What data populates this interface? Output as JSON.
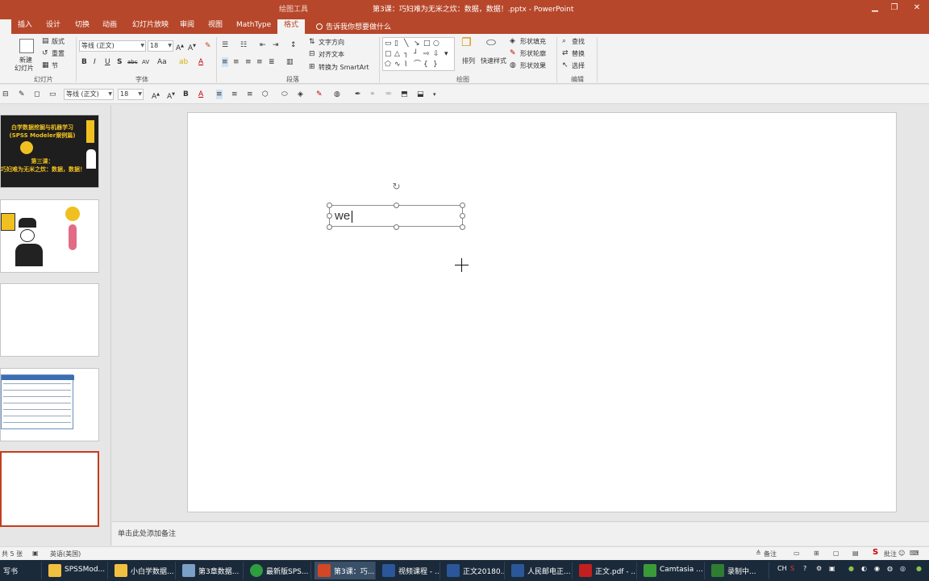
{
  "titlebar": {
    "tools_label": "绘图工具",
    "document_title": "第3课：巧妇难为无米之炊：数据，数据！.pptx  -  PowerPoint",
    "minimize": "▁",
    "restore": "❐",
    "close": "✕"
  },
  "tabs": [
    {
      "label": "插入"
    },
    {
      "label": "设计"
    },
    {
      "label": "切换"
    },
    {
      "label": "动画"
    },
    {
      "label": "幻灯片放映"
    },
    {
      "label": "审阅"
    },
    {
      "label": "视图"
    },
    {
      "label": "MathType"
    },
    {
      "label": "格式"
    }
  ],
  "tellme": "告诉我你想要做什么",
  "ribbon": {
    "slides_group": {
      "new_slide": "新建",
      "new_slide2": "幻灯片",
      "layout": "版式",
      "reset": "重置",
      "section": "节",
      "label": "幻灯片"
    },
    "font_group": {
      "font_name": "等线 (正文)",
      "font_size": "18",
      "label": "字体"
    },
    "paragraph_group": {
      "text_direction": "文字方向",
      "align_text": "对齐文本",
      "smartart": "转换为 SmartArt",
      "label": "段落"
    },
    "drawing_group": {
      "arrange": "排列",
      "quick_styles": "快速样式",
      "shape_fill": "形状填充",
      "shape_outline": "形状轮廓",
      "shape_effects": "形状效果",
      "label": "绘图"
    },
    "editing_group": {
      "find": "查找",
      "replace": "替换",
      "select": "选择",
      "label": "编辑"
    }
  },
  "format_bar": {
    "font_name": "等线 (正文)",
    "font_size": "18"
  },
  "thumbnails": {
    "slide1_line1": "白学数据挖掘与机器学习",
    "slide1_line2": "(SPSS Modeler案例篇)",
    "slide1_line3": "第三课：",
    "slide1_line4": "巧妇难为无米之炊：数据，数据！"
  },
  "slide": {
    "textbox_text": "we"
  },
  "notes": {
    "placeholder": "单击此处添加备注"
  },
  "status": {
    "slide_count": "共 5 张",
    "language": "英语(美国)",
    "notes_label": "备注",
    "comments_label": "批注"
  },
  "taskbar": {
    "items": [
      {
        "label": "写书"
      },
      {
        "label": "SPSSMod..."
      },
      {
        "label": "小白学数据..."
      },
      {
        "label": "第3章数据..."
      },
      {
        "label": "最新版SPS..."
      },
      {
        "label": "第3课：巧..."
      },
      {
        "label": "视频课程 - ..."
      },
      {
        "label": "正文20180..."
      },
      {
        "label": "人民邮电正..."
      },
      {
        "label": "正文.pdf - ..."
      },
      {
        "label": "Camtasia ..."
      },
      {
        "label": "录制中..."
      }
    ],
    "ime": "CH"
  },
  "colors": {
    "accent": "#b7472a",
    "selected_border": "#c43e1c",
    "taskbar": "#1b2a3a"
  }
}
